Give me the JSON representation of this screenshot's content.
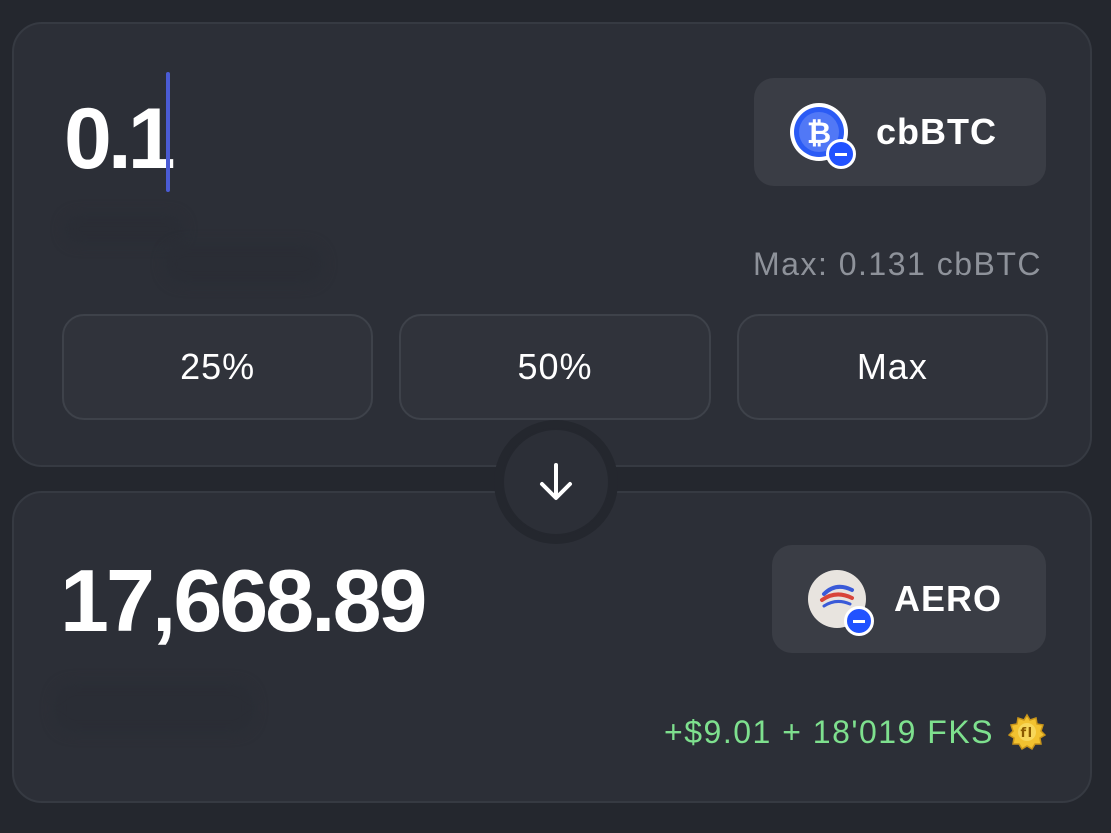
{
  "from": {
    "amount": "0.1",
    "token": {
      "symbol": "cbBTC",
      "icon": "bitcoin-icon",
      "chain_badge": "base-chain-icon"
    },
    "max_text": "Max: 0.131 cbBTC"
  },
  "percent_buttons": [
    {
      "label": "25%"
    },
    {
      "label": "50%"
    },
    {
      "label": "Max"
    }
  ],
  "swap_direction": {
    "icon": "arrow-down-icon"
  },
  "to": {
    "amount": "17,668.89",
    "token": {
      "symbol": "AERO",
      "icon": "aero-icon",
      "chain_badge": "base-chain-icon"
    },
    "reward_text": "+$9.01 + 18'019 FKS",
    "reward_icon": "gear-coin-icon"
  },
  "colors": {
    "background": "#24272e",
    "card": "#2c2f37",
    "token_button": "#3a3d45",
    "caret": "#4a5bd4",
    "reward_green": "#7ee08e",
    "muted_text": "#8e929a",
    "chain_badge": "#2152ff"
  }
}
